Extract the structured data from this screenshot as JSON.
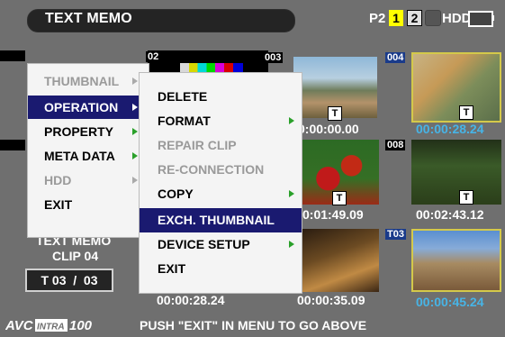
{
  "header": {
    "title": "TEXT MEMO",
    "p2_label": "P2",
    "slot1": "1",
    "slot2": "2",
    "hdd_label": "HDD"
  },
  "thumbnails": [
    {
      "number": "02"
    },
    {
      "number": "003",
      "time": "0:00:00.00",
      "badge": "T"
    },
    {
      "number": "004",
      "time": "00:00:28.24",
      "badge": "T"
    },
    {
      "number": "008",
      "time": "00:02:43.12",
      "badge": "T"
    },
    {
      "time": "0:01:49.09",
      "badge": "T"
    },
    {
      "number": "T03",
      "time": "00:00:45.24"
    },
    {
      "time": "00:00:28.24"
    },
    {
      "time": "00:00:35.09"
    }
  ],
  "info": {
    "line1": "TEXT MEMO",
    "line2": "CLIP 04",
    "line3": "T 03  /  03"
  },
  "left_menu": [
    {
      "label": "THUMBNAIL",
      "state": "dim"
    },
    {
      "label": "OPERATION",
      "state": "active"
    },
    {
      "label": "PROPERTY",
      "state": "normal"
    },
    {
      "label": "META DATA",
      "state": "normal"
    },
    {
      "label": "HDD",
      "state": "dim"
    },
    {
      "label": "EXIT",
      "state": "normal"
    }
  ],
  "right_menu": [
    {
      "label": "DELETE",
      "state": "normal"
    },
    {
      "label": "FORMAT",
      "state": "normal"
    },
    {
      "label": "REPAIR CLIP",
      "state": "dim"
    },
    {
      "label": "RE-CONNECTION",
      "state": "dim"
    },
    {
      "label": "COPY",
      "state": "normal"
    },
    {
      "label": "EXCH. THUMBNAIL",
      "state": "active"
    },
    {
      "label": "DEVICE SETUP",
      "state": "normal"
    },
    {
      "label": "EXIT",
      "state": "normal"
    }
  ],
  "footer": {
    "logo": "AVC INTRA 100",
    "message": "PUSH \"EXIT\" IN MENU TO GO ABOVE"
  },
  "colors": {
    "menu_highlight": "#1a1a70",
    "submenu_arrow": "#2aa02a",
    "slot_active": "#ffff00",
    "selected_frame": "#d4c94a",
    "time_selected": "#47b4e6"
  }
}
